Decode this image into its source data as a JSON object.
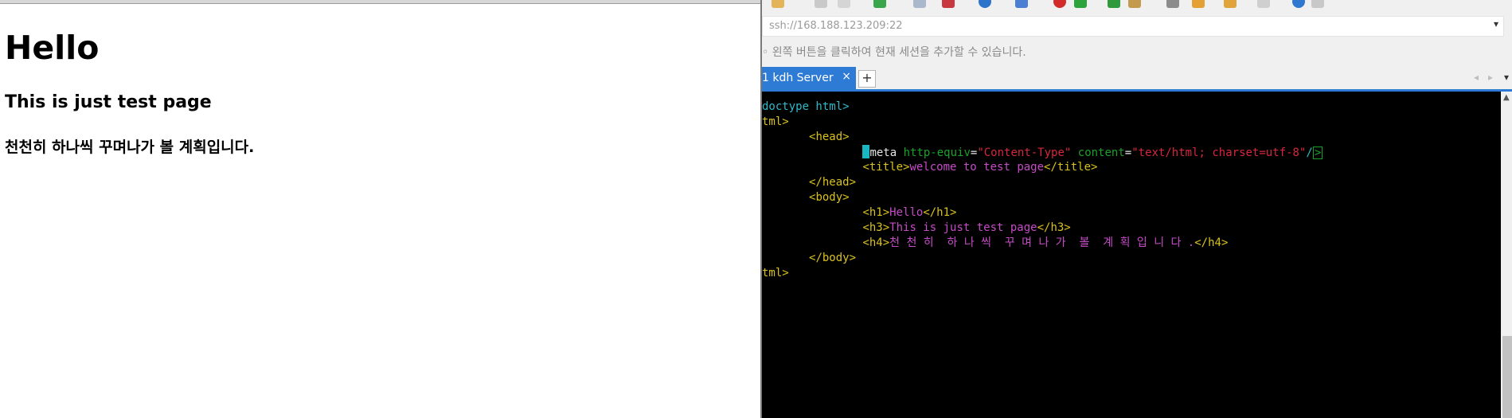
{
  "browser": {
    "h1": "Hello",
    "h3": "This is just test page",
    "h4": "천천히 하나씩 꾸며나가 볼 계획입니다."
  },
  "terminal_app": {
    "address": "ssh://168.188.123.209:22",
    "hint": "◦ 왼쪽 버튼을 클릭하여 현재 세션을 추가할 수 있습니다.",
    "tab_label": "1 kdh Server",
    "tab_close": "×",
    "tab_add": "+",
    "dropdown": "▾",
    "code_lines": [
      {
        "parts": [
          [
            "c-cyan",
            "doctype html>"
          ]
        ]
      },
      {
        "parts": [
          [
            "c-yellow",
            "tml>"
          ]
        ]
      },
      {
        "parts": [
          [
            "c-cyan",
            "       "
          ],
          [
            "c-yellow",
            "<head>"
          ]
        ]
      },
      {
        "parts": [
          [
            "c-cyan",
            "               "
          ],
          [
            "cursor",
            ""
          ],
          [
            "c-white",
            "meta "
          ],
          [
            "c-green",
            "http-equiv"
          ],
          [
            "c-white",
            "="
          ],
          [
            "c-red",
            "\"Content-Type\" "
          ],
          [
            "c-green",
            "content"
          ],
          [
            "c-white",
            "="
          ],
          [
            "c-red",
            "\"text/html; charset=utf-8\""
          ],
          [
            "c-cyan",
            "/"
          ],
          [
            "endbox",
            ">"
          ]
        ]
      },
      {
        "parts": [
          [
            "c-cyan",
            "               "
          ],
          [
            "c-yellow",
            "<title>"
          ],
          [
            "c-magenta",
            "welcome to test page"
          ],
          [
            "c-yellow",
            "</title>"
          ]
        ]
      },
      {
        "parts": [
          [
            "c-cyan",
            "       "
          ],
          [
            "c-yellow",
            "</head>"
          ]
        ]
      },
      {
        "parts": [
          [
            "c-cyan",
            "       "
          ],
          [
            "c-yellow",
            "<body>"
          ]
        ]
      },
      {
        "parts": [
          [
            "c-cyan",
            "               "
          ],
          [
            "c-yellow",
            "<h1>"
          ],
          [
            "c-magenta",
            "Hello"
          ],
          [
            "c-yellow",
            "</h1>"
          ]
        ]
      },
      {
        "parts": [
          [
            "c-cyan",
            "               "
          ],
          [
            "c-yellow",
            "<h3>"
          ],
          [
            "c-magenta",
            "This is just test page"
          ],
          [
            "c-yellow",
            "</h3>"
          ]
        ]
      },
      {
        "parts": [
          [
            "c-cyan",
            "               "
          ],
          [
            "c-yellow",
            "<h4>"
          ],
          [
            "c-magenta",
            "천 천 히  하 나 씩  꾸 며 나 가  볼  계 획 입 니 다 ."
          ],
          [
            "c-yellow",
            "</h4>"
          ]
        ]
      },
      {
        "parts": [
          [
            "c-cyan",
            "       "
          ],
          [
            "c-yellow",
            "</body>"
          ]
        ]
      },
      {
        "parts": [
          [
            "c-yellow",
            "tml>"
          ]
        ]
      }
    ],
    "colors": {
      "tab_accent": "#2e7bd6",
      "terminal_bg": "#000000",
      "tag_yellow": "#d9c21c",
      "attr_green": "#19a22a",
      "string_red": "#d7263d",
      "text_magenta": "#c64bc7",
      "doctype_cyan": "#2fb8c9"
    },
    "toolbar_icons": [
      "folder-icon",
      "disconnect-icon",
      "trash-icon",
      "settings-icon",
      "search-icon",
      "stop-icon",
      "globe-icon",
      "font-icon",
      "red-icon",
      "green-icon",
      "transfer-icon",
      "box-icon",
      "keyboard-icon",
      "upload-icon",
      "lock-icon",
      "doc-icon",
      "info-icon",
      "chat-icon"
    ]
  }
}
